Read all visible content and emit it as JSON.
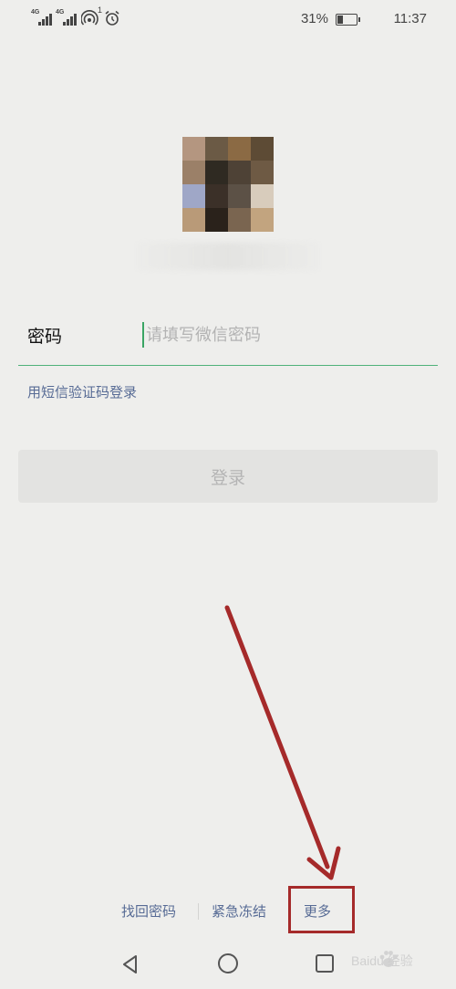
{
  "status_bar": {
    "signal_1_label": "4G",
    "signal_2_label": "4G",
    "hotspot_badge": "1",
    "icons": [
      "signal-icon",
      "signal-icon",
      "hotspot-icon",
      "alarm-icon",
      "battery-icon"
    ],
    "battery_percent_text": "31%",
    "battery_level": 0.31,
    "time": "11:37"
  },
  "account": {
    "avatar_masked": true,
    "masked_text_visible": false
  },
  "login_form": {
    "password_label": "密码",
    "password_placeholder": "请填写微信密码",
    "password_value": "",
    "sms_login_link": "用短信验证码登录",
    "login_button": "登录"
  },
  "bottom_links": {
    "find_password": "找回密码",
    "emergency_freeze": "紧急冻结",
    "more": "更多"
  },
  "annotation": {
    "arrow_color": "#a52a2a",
    "highlight_target": "more"
  },
  "nav_bar": {
    "icons": [
      "back-icon",
      "home-icon",
      "recent-apps-icon"
    ]
  },
  "watermark": {
    "text": "Baidu 经验"
  },
  "colors": {
    "background": "#eeeeec",
    "accent_green": "#3aa564",
    "link_blue": "#576b95",
    "button_disabled_bg": "#e3e3e1",
    "button_disabled_text": "#b4b4b4"
  }
}
